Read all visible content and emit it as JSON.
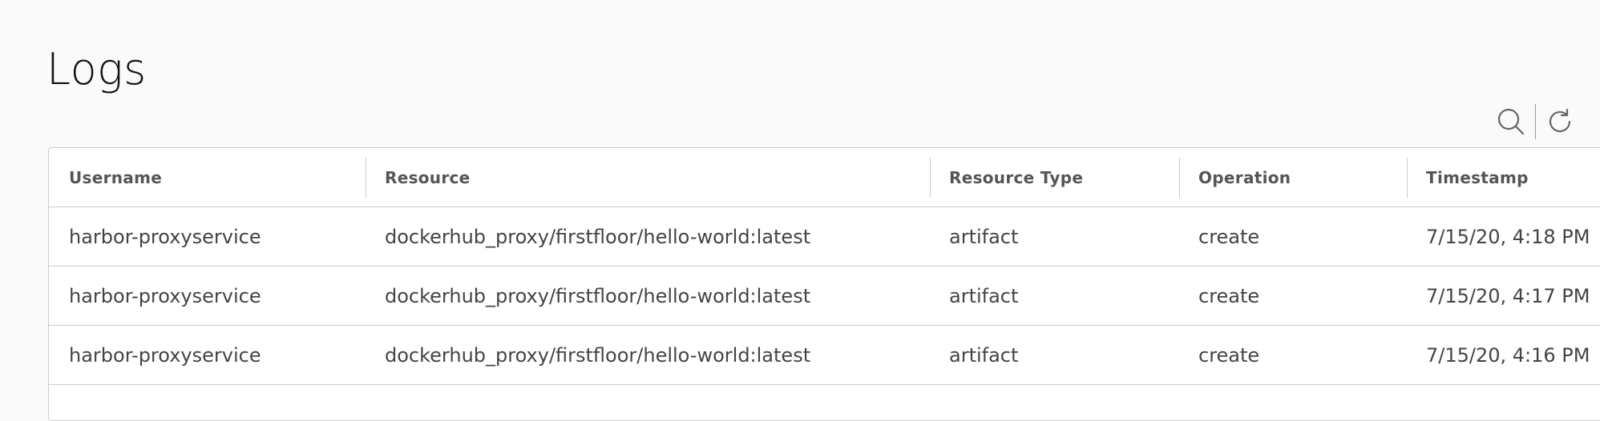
{
  "page": {
    "title": "Logs"
  },
  "toolbar": {
    "search_icon": "search-icon",
    "refresh_icon": "refresh-icon"
  },
  "table": {
    "columns": [
      "Username",
      "Resource",
      "Resource Type",
      "Operation",
      "Timestamp"
    ],
    "rows": [
      [
        "harbor-proxyservice",
        "dockerhub_proxy/firstfloor/hello-world:latest",
        "artifact",
        "create",
        "7/15/20, 4:18 PM"
      ],
      [
        "harbor-proxyservice",
        "dockerhub_proxy/firstfloor/hello-world:latest",
        "artifact",
        "create",
        "7/15/20, 4:17 PM"
      ],
      [
        "harbor-proxyservice",
        "dockerhub_proxy/firstfloor/hello-world:latest",
        "artifact",
        "create",
        "7/15/20, 4:16 PM"
      ]
    ]
  },
  "colors": {
    "background": "#fafafa",
    "grid_border": "#cccccc",
    "title": "#111111"
  }
}
